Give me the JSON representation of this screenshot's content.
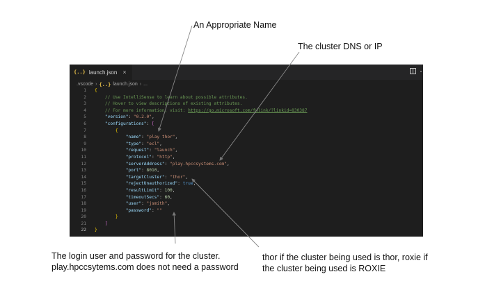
{
  "annotations": {
    "name": "An Appropriate Name",
    "dns": "The cluster DNS or IP",
    "login_line1": "The login user and password for the cluster.",
    "login_line2": "play.hpccsytems.com does not need a password",
    "target_line1": "thor  if the cluster being used is thor, roxie if",
    "target_line2": "the cluster being used is ROXIE"
  },
  "editor": {
    "tab": {
      "icon": "json-braces-icon",
      "icon_glyph": "{..}",
      "label": "launch.json",
      "close": "×"
    },
    "breadcrumb": [
      ".vscode",
      "{..}",
      "launch.json",
      "..."
    ],
    "breadcrumb_sep": "›",
    "active_line": 22,
    "lines": {
      "l2a": "// Use IntelliSense to learn about possible attributes.",
      "l3a": "// Hover to view descriptions of existing attributes.",
      "l4a": "// For more information, visit: ",
      "l4b": "https://go.microsoft.com/fwlink/?linkid=830387",
      "l5a": "\"version\"",
      "l5b": "\"0.2.0\"",
      "l6a": "\"configurations\"",
      "l8a": "\"name\"",
      "l8b": "\"play thor\"",
      "l9a": "\"type\"",
      "l9b": "\"ecl\"",
      "l10a": "\"request\"",
      "l10b": "\"launch\"",
      "l11a": "\"protocol\"",
      "l11b": "\"http\"",
      "l12a": "\"serverAddress\"",
      "l12b": "\"play.hpccsystems.com\"",
      "l13a": "\"port\"",
      "l13b": "8010",
      "l14a": "\"targetCluster\"",
      "l14b": "\"thor\"",
      "l15a": "\"rejectUnauthorized\"",
      "l15b": "true",
      "l16a": "\"resultLimit\"",
      "l16b": "100",
      "l17a": "\"timeoutSecs\"",
      "l17b": "60",
      "l18a": "\"user\"",
      "l18b": "\"jsmith\"",
      "l19a": "\"password\"",
      "l19b": "\"\""
    }
  }
}
